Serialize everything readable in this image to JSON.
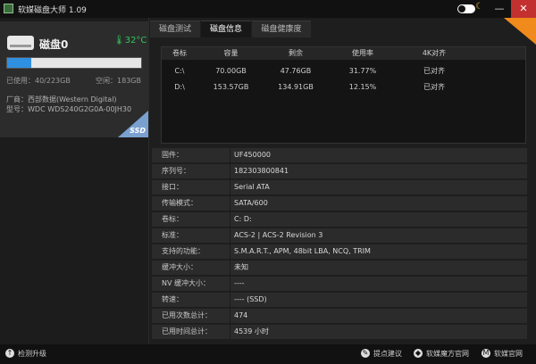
{
  "app": {
    "title": "软媒磁盘大师 1.09",
    "icon": "app-icon"
  },
  "window": {
    "minimize_icon": "minimize-icon",
    "close_icon": "close-icon",
    "minimize_glyph": "—",
    "close_glyph": "✕"
  },
  "theme_toggle": {
    "moon_glyph": "☾"
  },
  "disk": {
    "name": "磁盘0",
    "temperature": "32°C",
    "thermo_glyph": "🌡",
    "usage_fraction": 0.18,
    "used": "已使用：40/223GB",
    "free": "空闲：183GB",
    "vendor": "厂商：西部数据(Western Digital)",
    "model": "型号：WDC WDS240G2G0A-00JH30",
    "badge": "SSD",
    "bar_color": "#2f8fe0"
  },
  "tabs": [
    {
      "label": "磁盘测试"
    },
    {
      "label": "磁盘信息"
    },
    {
      "label": "磁盘健康度"
    }
  ],
  "partitions": {
    "headers": [
      "卷标",
      "容量",
      "剩余",
      "使用率",
      "4K对齐"
    ],
    "rows": [
      [
        "C:\\",
        "70.00GB",
        "47.76GB",
        "31.77%",
        "已对齐"
      ],
      [
        "D:\\",
        "153.57GB",
        "134.91GB",
        "12.15%",
        "已对齐"
      ]
    ]
  },
  "info": [
    {
      "k": "固件：",
      "v": "UF450000"
    },
    {
      "k": "序列号：",
      "v": "182303800841"
    },
    {
      "k": "接口：",
      "v": "Serial ATA"
    },
    {
      "k": "传输模式：",
      "v": "SATA/600"
    },
    {
      "k": "卷标：",
      "v": "C: D:"
    },
    {
      "k": "标准：",
      "v": "ACS-2 | ACS-2 Revision 3"
    },
    {
      "k": "支持的功能：",
      "v": "S.M.A.R.T., APM, 48bit LBA, NCQ, TRIM"
    },
    {
      "k": "缓冲大小：",
      "v": "未知"
    },
    {
      "k": "NV 缓冲大小：",
      "v": "----"
    },
    {
      "k": "转速：",
      "v": "---- (SSD)"
    },
    {
      "k": "已用次数总计：",
      "v": "474"
    },
    {
      "k": "已用时间总计：",
      "v": "4539 小时"
    }
  ],
  "footer": {
    "update": "检测升级",
    "update_glyph": "↑",
    "feedback": "提点建议",
    "feedback_glyph": "✎",
    "site1": "软媒魔方官网",
    "site1_glyph": "◆",
    "site2": "软媒官网",
    "site2_glyph": "M"
  },
  "colors": {
    "accent_orange": "#f08a1c",
    "temp_green": "#2ec85a",
    "close_red": "#c33030"
  }
}
